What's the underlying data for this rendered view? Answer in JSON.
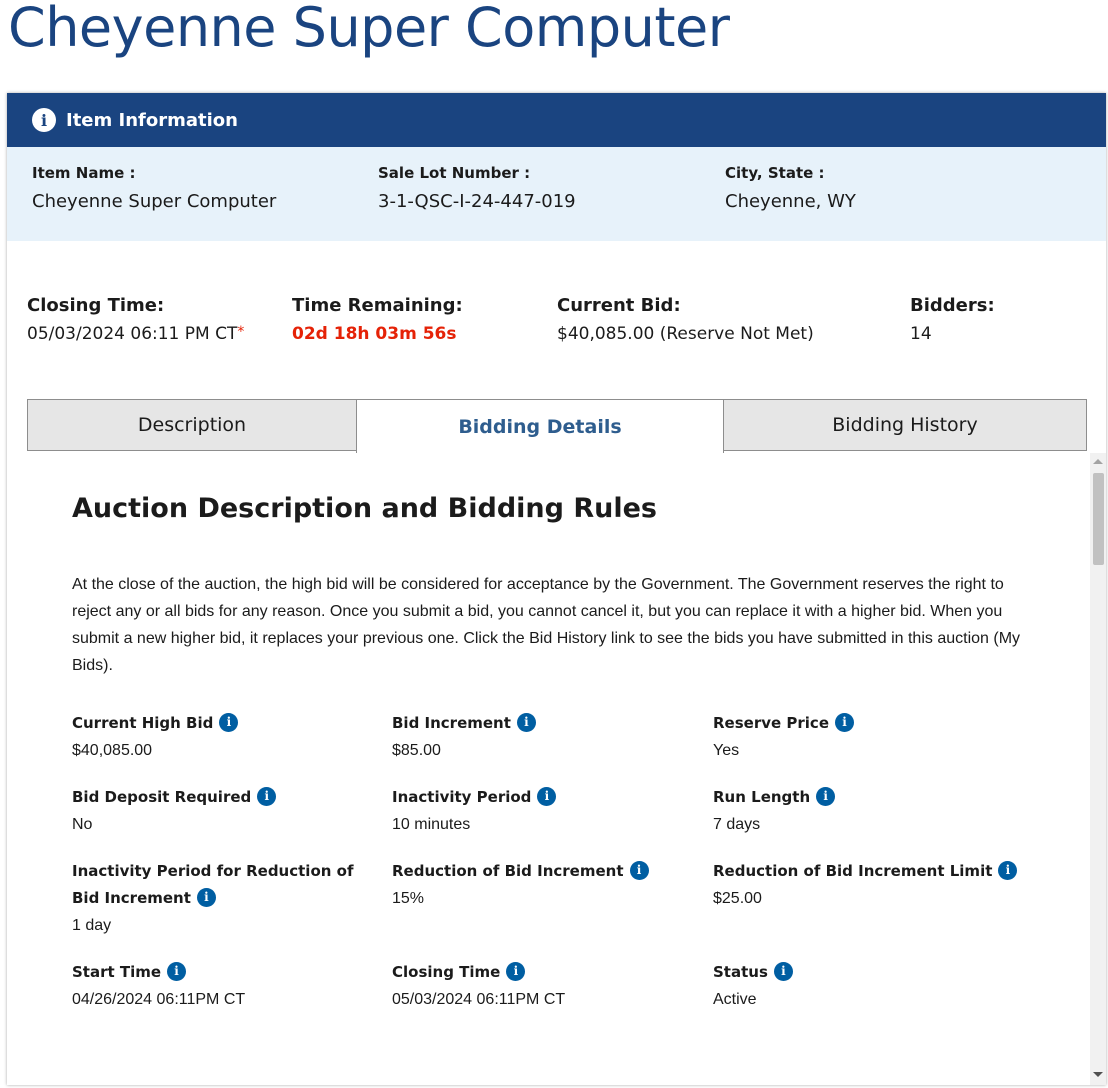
{
  "page": {
    "title": "Cheyenne Super Computer"
  },
  "card": {
    "header": "Item Information",
    "header_icon": "info-icon"
  },
  "item": {
    "name_label": "Item Name :",
    "name": "Cheyenne Super Computer",
    "lot_label": "Sale Lot Number :",
    "lot": "3-1-QSC-I-24-447-019",
    "city_label": "City, State :",
    "city": "Cheyenne, WY"
  },
  "stats": {
    "closing_label": "Closing Time:",
    "closing": "05/03/2024 06:11 PM CT",
    "closing_marker": "*",
    "remaining_label": "Time Remaining:",
    "remaining": "02d 18h 03m 56s",
    "bid_label": "Current Bid:",
    "bid": "$40,085.00 (Reserve Not Met)",
    "bidders_label": "Bidders:",
    "bidders": "14"
  },
  "tabs": [
    {
      "label": "Description",
      "active": false
    },
    {
      "label": "Bidding Details",
      "active": true
    },
    {
      "label": "Bidding History",
      "active": false
    }
  ],
  "details": {
    "title": "Auction Description and Bidding Rules",
    "description": "At the close of the auction, the high bid will be considered for acceptance by the Government. The Government reserves the right to reject any or all bids for any reason. Once you submit a bid, you cannot cancel it, but you can replace it with a higher bid. When you submit a new higher bid, it replaces your previous one. Click the Bid History link to see the bids you have submitted in this auction (My Bids).",
    "fields": [
      {
        "label": "Current High Bid",
        "value": "$40,085.00"
      },
      {
        "label": "Bid Increment",
        "value": "$85.00"
      },
      {
        "label": "Reserve Price",
        "value": "Yes"
      },
      {
        "label": "Bid Deposit Required",
        "value": "No"
      },
      {
        "label": "Inactivity Period",
        "value": "10 minutes"
      },
      {
        "label": "Run Length",
        "value": "7 days"
      },
      {
        "label": "Inactivity Period for Reduction of Bid Increment",
        "value": "1 day"
      },
      {
        "label": "Reduction of Bid Increment",
        "value": "15%"
      },
      {
        "label": "Reduction of Bid Increment Limit",
        "value": "$25.00"
      },
      {
        "label": "Start Time",
        "value": "04/26/2024 06:11PM CT"
      },
      {
        "label": "Closing Time",
        "value": "05/03/2024 06:11PM CT"
      },
      {
        "label": "Status",
        "value": "Active"
      }
    ]
  },
  "icons": {
    "info_glyph": "i"
  },
  "colors": {
    "brand": "#1a4480",
    "info_band": "#e7f2fa",
    "alert": "#e52207",
    "icon": "#005ea2"
  }
}
